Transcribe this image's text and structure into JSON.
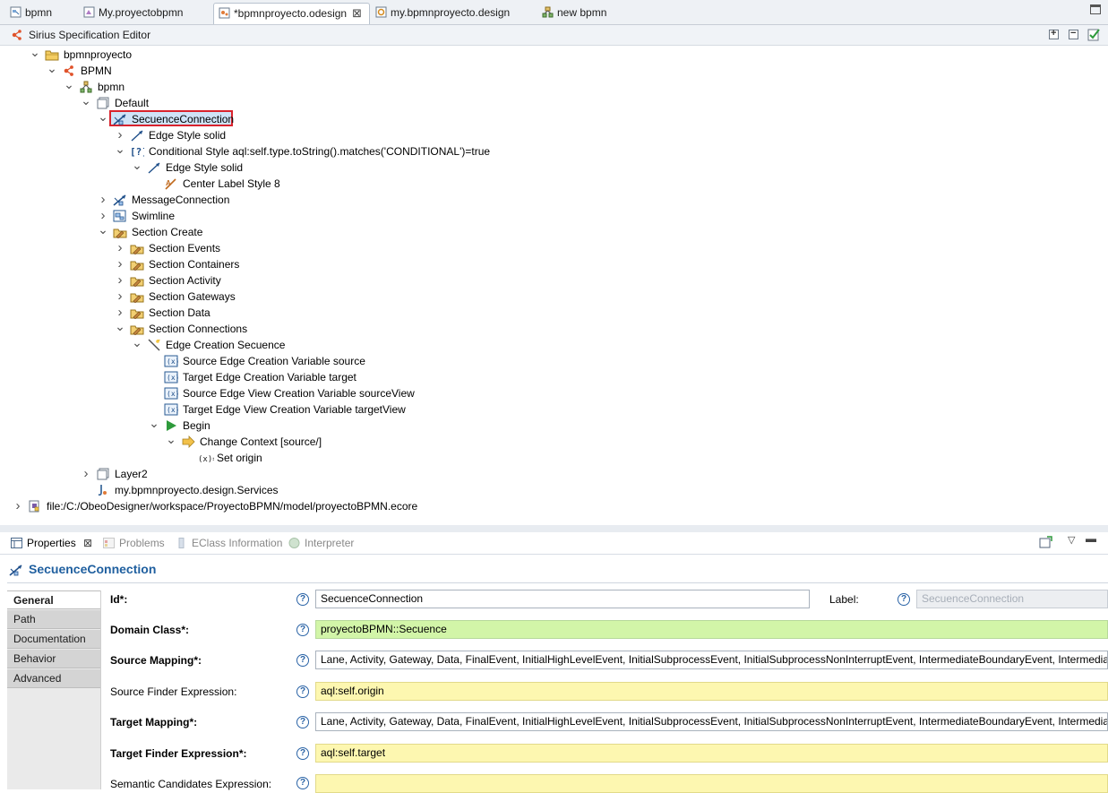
{
  "editor_tabs": [
    {
      "label": "bpmn",
      "icon": "diagram-file-icon",
      "active": false,
      "closable": false
    },
    {
      "label": "My.proyectobpmn",
      "icon": "model-file-icon",
      "active": false,
      "closable": false
    },
    {
      "label": "*bpmnproyecto.odesign",
      "icon": "odesign-file-icon",
      "active": true,
      "closable": true
    },
    {
      "label": "my.bpmnproyecto.design",
      "icon": "design-file-icon",
      "active": false,
      "closable": false
    },
    {
      "label": "new bpmn",
      "icon": "representation-icon",
      "active": false,
      "closable": false
    }
  ],
  "editor_header": {
    "title": "Sirius Specification Editor",
    "icon": "sirius-icon",
    "buttons": [
      "expand-all-button",
      "collapse-all-button",
      "validate-button"
    ]
  },
  "tree": [
    {
      "label": "bpmnproyecto",
      "icon": "folder-icon",
      "expanded": true
    },
    {
      "label": "BPMN",
      "icon": "viewpoint-icon",
      "expanded": true
    },
    {
      "label": "bpmn",
      "icon": "diagram-description-icon",
      "expanded": true
    },
    {
      "label": "Default",
      "icon": "layer-icon",
      "expanded": true
    },
    {
      "label": "SecuenceConnection",
      "icon": "edge-mapping-icon",
      "expanded": true,
      "selected": true
    },
    {
      "label": "Edge Style solid",
      "icon": "edge-style-icon",
      "expanded": false
    },
    {
      "label": "Conditional Style aql:self.type.toString().matches('CONDITIONAL')=true",
      "icon": "conditional-style-icon",
      "expanded": true
    },
    {
      "label": "Edge Style solid",
      "icon": "edge-style-icon",
      "expanded": true
    },
    {
      "label": "Center Label Style 8",
      "icon": "label-style-icon",
      "expanded": null
    },
    {
      "label": "MessageConnection",
      "icon": "edge-mapping-icon",
      "expanded": false
    },
    {
      "label": "Swimline",
      "icon": "container-mapping-icon",
      "expanded": false
    },
    {
      "label": "Section Create",
      "icon": "tool-section-icon",
      "expanded": true
    },
    {
      "label": "Section Events",
      "icon": "tool-section-icon",
      "expanded": false
    },
    {
      "label": "Section Containers",
      "icon": "tool-section-icon",
      "expanded": false
    },
    {
      "label": "Section Activity",
      "icon": "tool-section-icon",
      "expanded": false
    },
    {
      "label": "Section Gateways",
      "icon": "tool-section-icon",
      "expanded": false
    },
    {
      "label": "Section Data",
      "icon": "tool-section-icon",
      "expanded": false
    },
    {
      "label": "Section Connections",
      "icon": "tool-section-icon",
      "expanded": true
    },
    {
      "label": "Edge Creation Secuence",
      "icon": "edge-creation-icon",
      "expanded": true
    },
    {
      "label": "Source Edge Creation Variable source",
      "icon": "variable-icon",
      "expanded": null
    },
    {
      "label": "Target Edge Creation Variable target",
      "icon": "variable-icon",
      "expanded": null
    },
    {
      "label": "Source Edge View Creation Variable sourceView",
      "icon": "variable-icon",
      "expanded": null
    },
    {
      "label": "Target Edge View Creation Variable targetView",
      "icon": "variable-icon",
      "expanded": null
    },
    {
      "label": "Begin",
      "icon": "begin-icon",
      "expanded": true
    },
    {
      "label": "Change Context [source/]",
      "icon": "change-context-icon",
      "expanded": true
    },
    {
      "label": "Set origin",
      "icon": "set-value-icon",
      "expanded": null
    },
    {
      "label": "Layer2",
      "icon": "layer-icon",
      "expanded": false
    },
    {
      "label": "my.bpmnproyecto.design.Services",
      "icon": "java-extension-icon",
      "expanded": null
    },
    {
      "label": "file:/C:/ObeoDesigner/workspace/ProyectoBPMN/model/proyectoBPMN.ecore",
      "icon": "ecore-resource-icon",
      "expanded": false
    }
  ],
  "view_tabs": [
    {
      "label": "Properties",
      "icon": "properties-icon",
      "active": true,
      "closable": true
    },
    {
      "label": "Problems",
      "icon": "problems-icon",
      "active": false
    },
    {
      "label": "EClass Information",
      "icon": "eclass-info-icon",
      "active": false
    },
    {
      "label": "Interpreter",
      "icon": "interpreter-icon",
      "active": false
    }
  ],
  "properties": {
    "title": "SecuenceConnection",
    "title_icon": "edge-mapping-icon",
    "categories": [
      "General",
      "Path",
      "Documentation",
      "Behavior",
      "Advanced"
    ],
    "active_category": "General",
    "help_glyph": "?",
    "fields": [
      {
        "label": "Id*:",
        "value": "SecuenceConnection",
        "style": "white",
        "required": true
      },
      {
        "label": "Domain Class*:",
        "value": "proyectoBPMN::Secuence",
        "style": "green",
        "required": true
      },
      {
        "label": "Source Mapping*:",
        "value": "Lane, Activity, Gateway, Data, FinalEvent, InitialHighLevelEvent, InitialSubprocessEvent, InitialSubprocessNonInterruptEvent, IntermediateBoundaryEvent, IntermediateB",
        "style": "white",
        "required": true
      },
      {
        "label": "Source Finder Expression:",
        "value": "aql:self.origin",
        "style": "yellow",
        "required": false
      },
      {
        "label": "Target Mapping*:",
        "value": "Lane, Activity, Gateway, Data, FinalEvent, InitialHighLevelEvent, InitialSubprocessEvent, InitialSubprocessNonInterruptEvent, IntermediateBoundaryEvent, IntermediateB",
        "style": "white",
        "required": true
      },
      {
        "label": "Target Finder Expression*:",
        "value": "aql:self.target",
        "style": "yellow",
        "required": true
      },
      {
        "label": "Semantic Candidates Expression:",
        "value": "",
        "style": "yellow",
        "required": false
      }
    ],
    "label_field": {
      "label": "Label:",
      "value": "SecuenceConnection",
      "disabled": true
    }
  },
  "colors": {
    "selection_highlight": "#d9232d",
    "selection_bg": "#cfe3f7",
    "properties_title": "#1f5f9f",
    "domain_class_bg": "#d2f5a8",
    "expression_bg": "#fdf7b0"
  }
}
